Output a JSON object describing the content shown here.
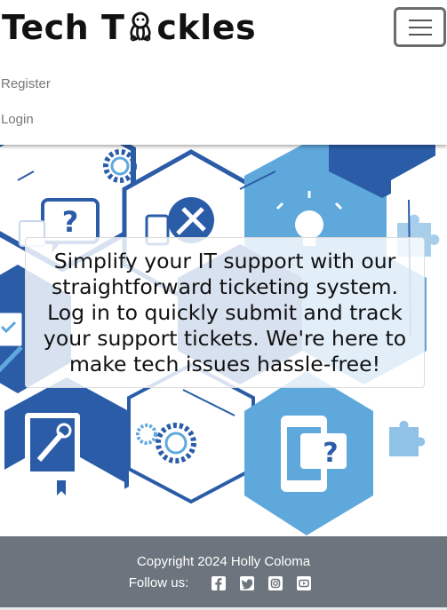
{
  "brand": {
    "name_part1": "Tech T",
    "name_part2": "ckles",
    "logo_icon": "octopus-icon"
  },
  "nav": {
    "toggler_icon": "hamburger-menu-icon",
    "register_label": "Register",
    "login_label": "Login"
  },
  "hero": {
    "message": "Simplify your IT support with our straightforward ticketing system. Log in to quickly submit and track your support tickets. We're here to make tech issues hassle-free!",
    "illustration_icons": [
      "question-chat-icon",
      "tools-icon",
      "lightbulb-icon",
      "puzzle-icon",
      "checklist-icon",
      "gear-icon",
      "manual-icon",
      "mobile-question-icon"
    ]
  },
  "footer": {
    "copyright": "Copyright 2024 Holly Coloma",
    "follow_label": "Follow us:",
    "socials": [
      "facebook-icon",
      "twitter-icon",
      "instagram-icon",
      "youtube-icon"
    ]
  },
  "colors": {
    "navy": "#2b5ca8",
    "light_blue": "#5fa8dc",
    "footer_gray": "#6c757d",
    "gold": "#e0a12c"
  }
}
